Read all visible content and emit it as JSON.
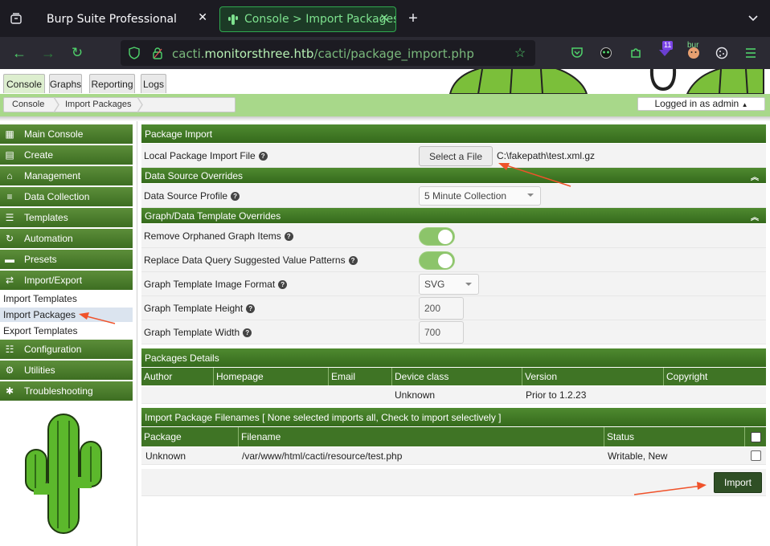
{
  "browser": {
    "tabs": [
      {
        "label": "Burp Suite Professional"
      },
      {
        "label": "Console > Import Packages"
      }
    ],
    "url_host_prefix": "cacti.",
    "url_host_domain": "monitorsthree.htb",
    "url_path": "/cacti/package_import.php",
    "badge_count": "11",
    "burp_label": "bur"
  },
  "app": {
    "tabs": [
      "Console",
      "Graphs",
      "Reporting",
      "Logs"
    ],
    "breadcrumb": [
      "Console",
      "Import Packages"
    ],
    "login_status": "Logged in as admin"
  },
  "sidebar": {
    "items": [
      {
        "label": "Main Console",
        "icon": "map-icon"
      },
      {
        "label": "Create",
        "icon": "chart-icon"
      },
      {
        "label": "Management",
        "icon": "home-icon"
      },
      {
        "label": "Data Collection",
        "icon": "database-icon"
      },
      {
        "label": "Templates",
        "icon": "list-icon"
      },
      {
        "label": "Automation",
        "icon": "refresh-icon"
      },
      {
        "label": "Presets",
        "icon": "folder-icon"
      },
      {
        "label": "Import/Export",
        "icon": "swap-icon"
      }
    ],
    "sub_items": [
      "Import Templates",
      "Import Packages",
      "Export Templates"
    ],
    "items_bottom": [
      {
        "label": "Configuration",
        "icon": "sliders-icon"
      },
      {
        "label": "Utilities",
        "icon": "gears-icon"
      },
      {
        "label": "Troubleshooting",
        "icon": "bug-icon"
      }
    ]
  },
  "main": {
    "package_import_header": "Package Import",
    "local_file_label": "Local Package Import File",
    "select_file_button": "Select a File",
    "selected_file": "C:\\fakepath\\test.xml.gz",
    "ds_overrides_header": "Data Source Overrides",
    "ds_profile_label": "Data Source Profile",
    "ds_profile_value": "5 Minute Collection",
    "graph_overrides_header": "Graph/Data Template Overrides",
    "remove_orphaned_label": "Remove Orphaned Graph Items",
    "replace_patterns_label": "Replace Data Query Suggested Value Patterns",
    "image_format_label": "Graph Template Image Format",
    "image_format_value": "SVG",
    "height_label": "Graph Template Height",
    "height_value": "200",
    "width_label": "Graph Template Width",
    "width_value": "700",
    "details_header": "Packages Details",
    "details_columns": [
      "Author",
      "Homepage",
      "Email",
      "Device class",
      "Version",
      "Copyright"
    ],
    "details_row": [
      "",
      "",
      "",
      "Unknown",
      "Prior to 1.2.23",
      ""
    ],
    "filenames_header": "Import Package Filenames [ None selected imports all, Check to import selectively ]",
    "filenames_columns": [
      "Package",
      "Filename",
      "Status"
    ],
    "filenames_row": [
      "Unknown",
      "/var/www/html/cacti/resource/test.php",
      "Writable, New"
    ],
    "import_button": "Import"
  }
}
